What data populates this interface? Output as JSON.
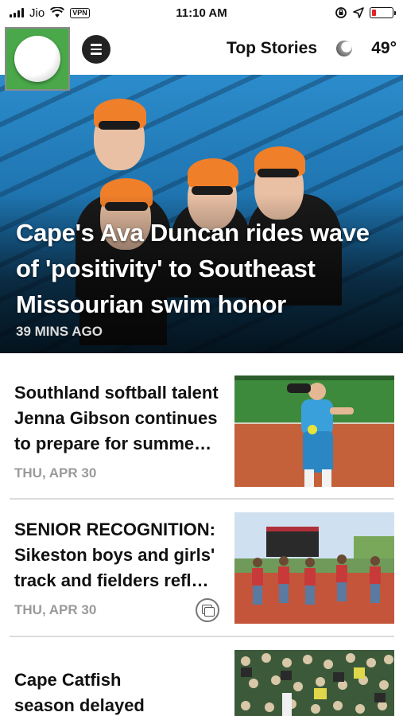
{
  "status_bar": {
    "carrier": "Jio",
    "vpn": "VPN",
    "time": "11:10 AM"
  },
  "header": {
    "section_title": "Top Stories",
    "temperature": "49°",
    "icons": [
      "app-logo-icon",
      "menu-icon",
      "weather-icon"
    ]
  },
  "hero": {
    "title": "Cape's Ava Duncan rides wave of 'positivity' to Southeast Missourian swim honor",
    "time": "39 MINS AGO"
  },
  "stories": [
    {
      "title": "Southland softball talent Jenna Gibson continues to prepare for summe…",
      "date": "THU, APR 30",
      "thumbnail": "softball-pitcher-photo"
    },
    {
      "title": "SENIOR RECOGNITION: Sikeston boys and girls' track and fielders refl…",
      "date": "THU, APR 30",
      "thumbnail": "track-team-photo",
      "badge_icon": "gallery-icon"
    },
    {
      "title": "Cape Catfish season delayed",
      "thumbnail": "baseball-crowd-photo"
    }
  ],
  "colors": {
    "logo_green": "#4aa84a",
    "battery_low": "#e0242a",
    "meta_gray": "#9a9a9a"
  }
}
